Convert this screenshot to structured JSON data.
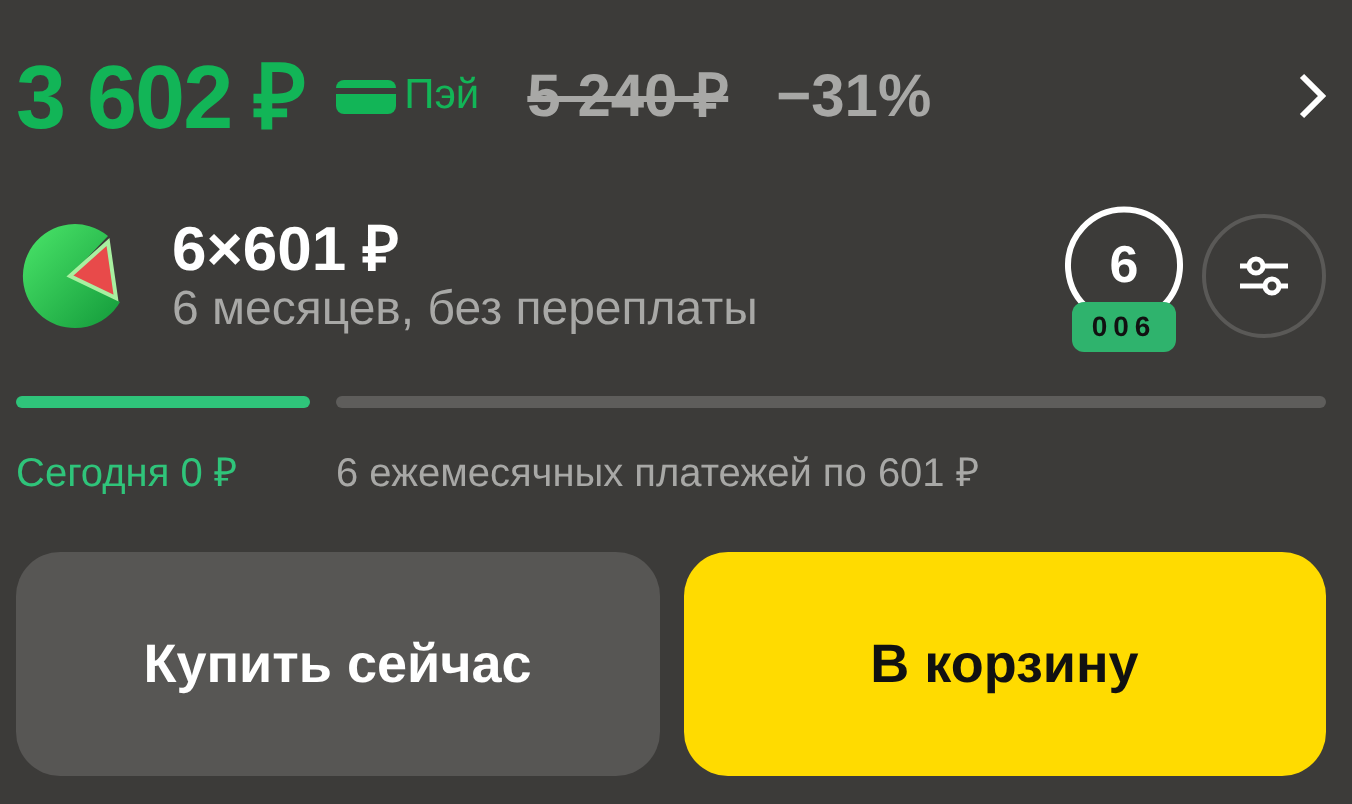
{
  "price": {
    "current": "3 602 ₽",
    "pay_label": "Пэй",
    "old": "5 240 ₽",
    "discount": "−31%"
  },
  "installment": {
    "title": "6×601 ₽",
    "subtitle": "6 месяцев, без переплаты",
    "term": "6",
    "term_badge": "006"
  },
  "schedule": [
    {
      "label": "Сегодня 0 ₽",
      "selected": true
    },
    {
      "label": "6 ежемесячных платежей по 601 ₽",
      "selected": false
    }
  ],
  "buttons": [
    {
      "label": "Купить сейчас",
      "kind": "secondary"
    },
    {
      "label": "В корзину",
      "kind": "primary"
    }
  ]
}
